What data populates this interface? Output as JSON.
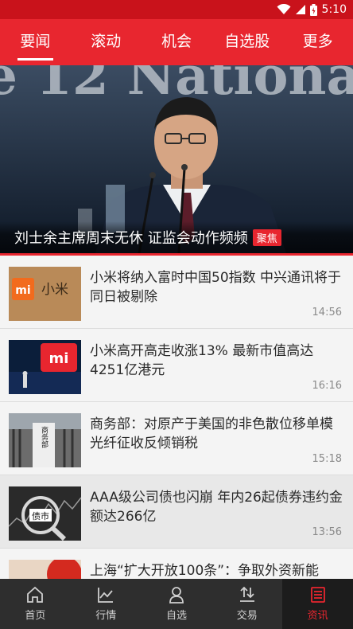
{
  "status_bar": {
    "time": "5:10"
  },
  "top_nav": {
    "tabs": [
      {
        "label": "要闻",
        "active": true
      },
      {
        "label": "滚动",
        "active": false
      },
      {
        "label": "机会",
        "active": false
      },
      {
        "label": "自选股",
        "active": false
      },
      {
        "label": "更多",
        "active": false
      }
    ]
  },
  "hero": {
    "title": "刘士余主席周末无休 证监会动作频频",
    "tag": "聚焦",
    "background_text": "e 12 National"
  },
  "news": [
    {
      "title": "小米将纳入富时中国50指数 中兴通讯将于同日被剔除",
      "time": "14:56",
      "thumb_text": "小米"
    },
    {
      "title": "小米高开高走收涨13% 最新市值高达4251亿港元",
      "time": "16:16",
      "thumb_text": "mi"
    },
    {
      "title": "商务部：对原产于美国的非色散位移单模光纤征收反倾销税",
      "time": "15:18",
      "thumb_text": "商务部"
    },
    {
      "title": "AAA级公司债也闪崩 年内26起债券违约金额达266亿",
      "time": "13:56",
      "thumb_text": "债市"
    },
    {
      "title": "上海“扩大开放100条”：争取外资新能",
      "time": ""
    }
  ],
  "bottom_nav": {
    "items": [
      {
        "label": "首页",
        "icon": "home-icon",
        "active": false
      },
      {
        "label": "行情",
        "icon": "chart-icon",
        "active": false
      },
      {
        "label": "自选",
        "icon": "user-icon",
        "active": false
      },
      {
        "label": "交易",
        "icon": "trade-icon",
        "active": false
      },
      {
        "label": "资讯",
        "icon": "news-icon",
        "active": true
      }
    ]
  },
  "colors": {
    "brand_red": "#e8262f",
    "status_red": "#c9121b",
    "bottom_bg": "#2e2e2e"
  }
}
